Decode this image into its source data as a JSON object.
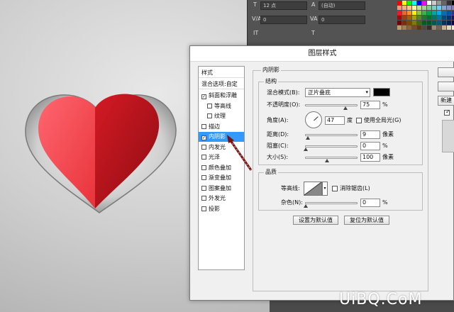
{
  "dialog": {
    "title": "图层样式"
  },
  "style_list": {
    "header": "样式",
    "blend_options": "混合选项:自定",
    "items": [
      {
        "label": "斜面和浮雕",
        "checked": true,
        "sub": false
      },
      {
        "label": "等高线",
        "checked": false,
        "sub": true
      },
      {
        "label": "纹理",
        "checked": false,
        "sub": true
      },
      {
        "label": "描边",
        "checked": false,
        "sub": false
      },
      {
        "label": "内阴影",
        "checked": true,
        "sub": false,
        "selected": true
      },
      {
        "label": "内发光",
        "checked": false,
        "sub": false
      },
      {
        "label": "光泽",
        "checked": false,
        "sub": false
      },
      {
        "label": "颜色叠加",
        "checked": false,
        "sub": false
      },
      {
        "label": "渐变叠加",
        "checked": false,
        "sub": false
      },
      {
        "label": "图案叠加",
        "checked": false,
        "sub": false
      },
      {
        "label": "外发光",
        "checked": false,
        "sub": false
      },
      {
        "label": "投影",
        "checked": false,
        "sub": false
      }
    ]
  },
  "inner_shadow": {
    "section_title": "内阴影",
    "structure_title": "结构",
    "blend_mode_label": "混合模式(B):",
    "blend_mode_value": "正片叠底",
    "shadow_color": "#000000",
    "opacity_label": "不透明度(O):",
    "opacity_value": "75",
    "opacity_unit": "%",
    "opacity_level": 0.75,
    "angle_label": "角度(A):",
    "angle_value": "47",
    "angle_unit": "度",
    "global_light_label": "使用全局光(G)",
    "distance_label": "距离(D):",
    "distance_value": "9",
    "distance_unit": "像素",
    "choke_label": "阻塞(C):",
    "choke_value": "0",
    "choke_unit": "%",
    "size_label": "大小(S):",
    "size_value": "100",
    "size_unit": "像素",
    "quality_title": "品质",
    "contour_label": "等高线:",
    "antialias_label": "消除锯齿(L)",
    "noise_label": "杂色(N):",
    "noise_value": "0",
    "noise_unit": "%",
    "set_default_label": "设置为默认值",
    "reset_default_label": "复位为默认值"
  },
  "right_buttons": {
    "new_style_label": "新建"
  },
  "ps_panel": {
    "field_1": "12 点",
    "field_2": "(自动)",
    "field_3": "0",
    "field_4": "0"
  },
  "watermark": {
    "text": "UiBQ.CoM"
  },
  "colors": {
    "heart_left": "#e8333a",
    "heart_right": "#b0121b",
    "selection": "#3399ff"
  }
}
